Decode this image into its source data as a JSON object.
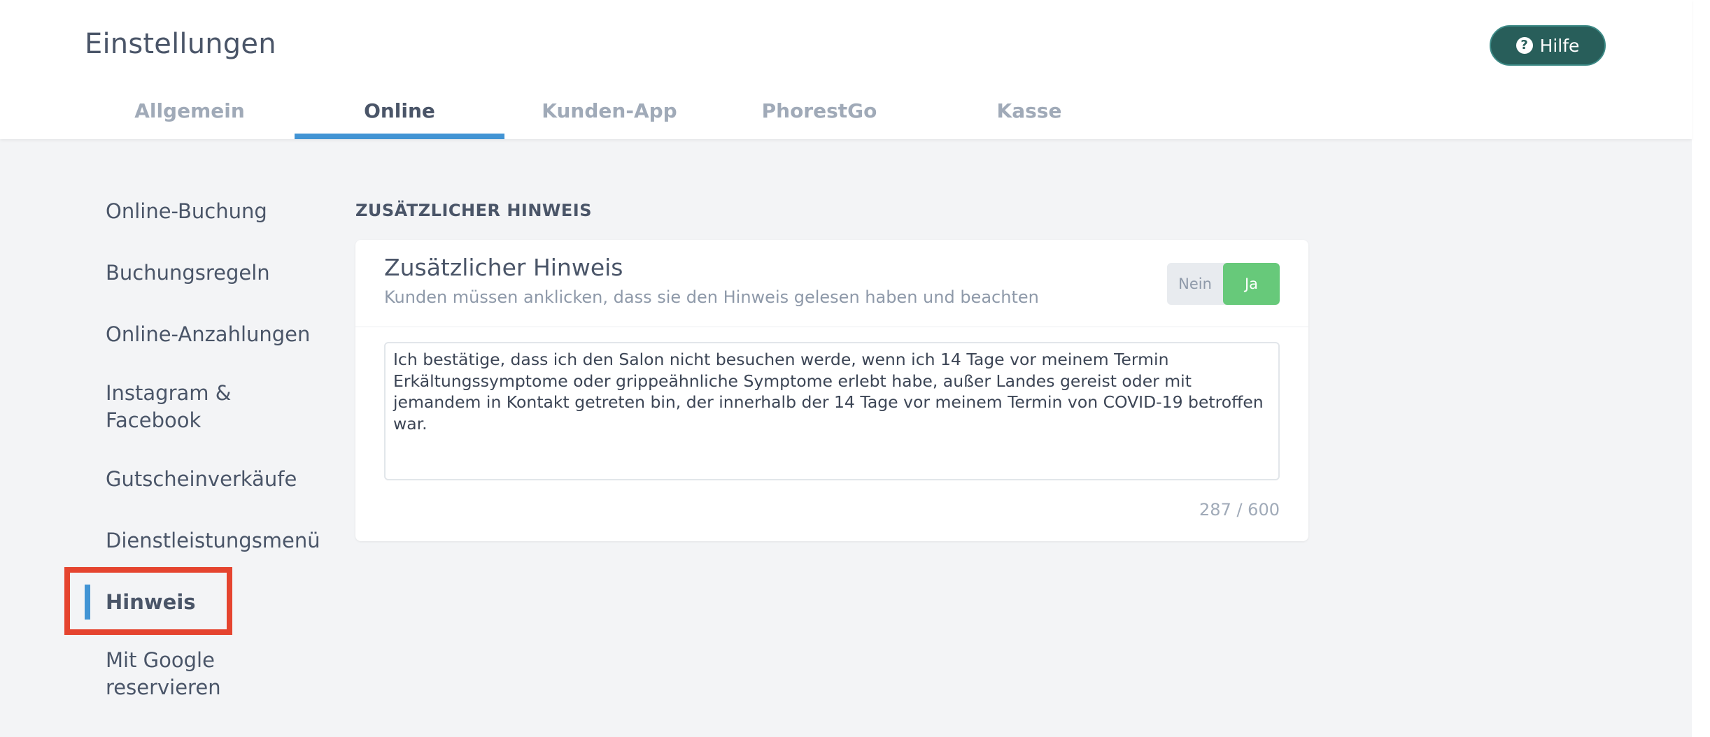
{
  "header": {
    "title": "Einstellungen",
    "help_label": "Hilfe",
    "help_icon": "question-circle-icon"
  },
  "tabs": [
    {
      "label": "Allgemein",
      "active": false
    },
    {
      "label": "Online",
      "active": true
    },
    {
      "label": "Kunden-App",
      "active": false
    },
    {
      "label": "PhorestGo",
      "active": false
    },
    {
      "label": "Kasse",
      "active": false
    }
  ],
  "sidebar": {
    "items": [
      {
        "label": "Online-Buchung"
      },
      {
        "label": "Buchungsregeln"
      },
      {
        "label": "Online-Anzahlungen"
      },
      {
        "label": "Instagram &",
        "label2": "Facebook"
      },
      {
        "label": "Gutscheinverkäufe"
      },
      {
        "label": "Dienstleistungsmenü"
      },
      {
        "label": "Hinweis",
        "active": true
      },
      {
        "label": "Mit Google",
        "label2": "reservieren"
      }
    ]
  },
  "content": {
    "section_title": "ZUSÄTZLICHER HINWEIS",
    "card": {
      "title": "Zusätzlicher Hinweis",
      "subtitle": "Kunden müssen anklicken, dass sie den Hinweis gelesen haben und beachten",
      "toggle": {
        "off_label": "Nein",
        "on_label": "Ja",
        "selected": "Ja"
      },
      "notice_text": "Ich bestätige, dass ich den Salon nicht besuchen werde, wenn ich 14 Tage vor meinem Termin Erkältungssymptome oder grippeähnliche Symptome erlebt habe, außer Landes gereist oder mit jemandem in Kontakt getreten bin, der innerhalb der 14 Tage vor meinem Termin von COVID-19 betroffen war.",
      "char_count": "287 / 600"
    }
  },
  "colors": {
    "accent": "#4294d4",
    "help_button": "#285e5a",
    "toggle_on": "#67c97a",
    "highlight": "#e5442f",
    "background": "#f3f4f6"
  }
}
